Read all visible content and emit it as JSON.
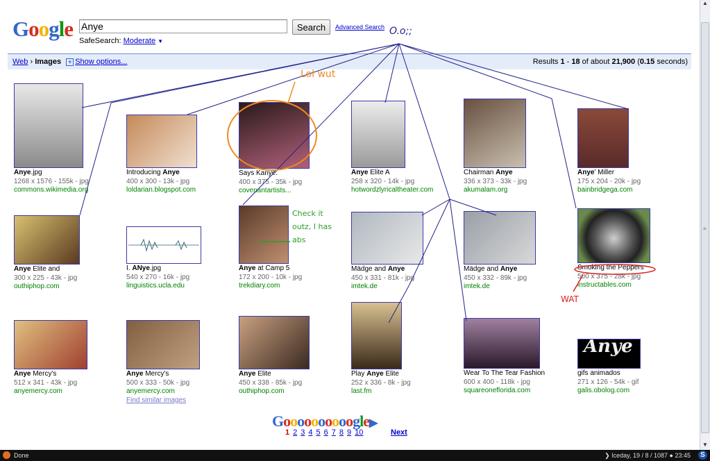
{
  "header": {
    "logo_letters": [
      {
        "ch": "G",
        "color": "#3366cc"
      },
      {
        "ch": "o",
        "color": "#d62d20"
      },
      {
        "ch": "o",
        "color": "#f4b400"
      },
      {
        "ch": "g",
        "color": "#3366cc"
      },
      {
        "ch": "l",
        "color": "#109618"
      },
      {
        "ch": "e",
        "color": "#d62d20"
      }
    ],
    "search_value": "Anye",
    "search_button": "Search",
    "advanced_link": "Advanced Search",
    "safesearch_label": "SafeSearch:",
    "safesearch_value": "Moderate",
    "safesearch_arrow": "▼"
  },
  "results_bar": {
    "web": "Web",
    "sep": "›",
    "images": "Images",
    "show_options": "Show options...",
    "results_pre": "Results ",
    "range_start": "1",
    "range_sep": " - ",
    "range_end": "18",
    "of_about": " of about ",
    "total": "21,900",
    "time_pre": " (",
    "time": "0.15",
    "time_post": " seconds)"
  },
  "results": [
    {
      "title_bold": "Anye",
      "title_rest": ".jpg",
      "meta": "1268 x 1576 - 155k - jpg",
      "site": "commons.wikimedia.org"
    },
    {
      "title_pre": "Introducing ",
      "title_bold": "Anye",
      "title_rest": "",
      "meta": "400 x 300 - 13k - jpg",
      "site": "loldarian.blogspot.com"
    },
    {
      "title_pre": "Says Kanye:",
      "title_bold": "",
      "title_rest": "",
      "meta": "400 x 375 - 35k - jpg",
      "site": "covenantartists..."
    },
    {
      "title_bold": "Anye",
      "title_rest": " Elite A",
      "meta": "258 x 320 - 14k - jpg",
      "site": "hotwordzlyricaltheater.com"
    },
    {
      "title_pre": "Chairman ",
      "title_bold": "Anye",
      "title_rest": "",
      "meta": "336 x 373 - 33k - jpg",
      "site": "akumalam.org"
    },
    {
      "title_bold": "Anye",
      "title_rest": "' Miller",
      "meta": "175 x 204 - 20k - jpg",
      "site": "bainbridgega.com"
    },
    {
      "title_bold": "Anye",
      "title_rest": " Elite and",
      "meta": "300 x 225 - 43k - jpg",
      "site": "outhiphop.com"
    },
    {
      "title_pre": "I. ",
      "title_bold": "ANye",
      "title_rest": ".jpg",
      "meta": "540 x 270 - 16k - jpg",
      "site": "linguistics.ucla.edu"
    },
    {
      "title_bold": "Anye",
      "title_rest": " at Camp 5",
      "meta": "172 x 200 - 10k - jpg",
      "site": "trekdiary.com"
    },
    {
      "title_pre": "Mädge and ",
      "title_bold": "Anye",
      "title_rest": "",
      "meta": "450 x 331 - 81k - jpg",
      "site": "imtek.de"
    },
    {
      "title_pre": "Mädge and ",
      "title_bold": "Anye",
      "title_rest": "",
      "meta": "450 x 332 - 89k - jpg",
      "site": "imtek.de"
    },
    {
      "title_pre": "Smoking the Peppers",
      "title_bold": "",
      "title_rest": "",
      "meta": "500 x 375 - 28k - jpg",
      "site": "instructables.com"
    },
    {
      "title_bold": "Anye",
      "title_rest": " Mercy's",
      "meta": "512 x 341 - 43k - jpg",
      "site": "anyemercy.com"
    },
    {
      "title_bold": "Anye",
      "title_rest": " Mercy's",
      "meta": "500 x 333 - 50k - jpg",
      "site": "anyemercy.com",
      "similar": "Find similar images"
    },
    {
      "title_bold": "Anye",
      "title_rest": " Elite",
      "meta": "450 x 338 - 85k - jpg",
      "site": "outhiphop.com"
    },
    {
      "title_pre": "Play ",
      "title_bold": "Anye",
      "title_rest": " Elite",
      "meta": "252 x 336 - 8k - jpg",
      "site": "last.fm"
    },
    {
      "title_pre": "Wear To The Tear Fashion",
      "title_bold": "",
      "title_rest": "",
      "meta": "600 x 400 - 118k - jpg",
      "site": "squareoneflorida.com"
    },
    {
      "title_pre": "gifs animados",
      "title_bold": "",
      "title_rest": "",
      "meta": "271 x 126 - 54k - gif",
      "site": "galis.obolog.com",
      "thumb_text": "Anye"
    }
  ],
  "pagination": {
    "goo_letters": [
      {
        "ch": "G",
        "color": "#3366cc"
      },
      {
        "ch": "o",
        "color": "#d62d20"
      },
      {
        "ch": "o",
        "color": "#f4b400"
      },
      {
        "ch": "o",
        "color": "#3366cc"
      },
      {
        "ch": "o",
        "color": "#d62d20"
      },
      {
        "ch": "o",
        "color": "#f4b400"
      },
      {
        "ch": "o",
        "color": "#3366cc"
      },
      {
        "ch": "o",
        "color": "#d62d20"
      },
      {
        "ch": "o",
        "color": "#f4b400"
      },
      {
        "ch": "o",
        "color": "#3366cc"
      },
      {
        "ch": "o",
        "color": "#d62d20"
      },
      {
        "ch": "g",
        "color": "#3366cc"
      },
      {
        "ch": "l",
        "color": "#109618"
      },
      {
        "ch": "e",
        "color": "#d62d20"
      }
    ],
    "arrow": "▶",
    "pages": [
      "1",
      "2",
      "3",
      "4",
      "5",
      "6",
      "7",
      "8",
      "9",
      "10"
    ],
    "current": "1",
    "next": "Next"
  },
  "status": {
    "done": "Done",
    "clock": "❯ Iceday, 19 / 8 / 1087  ● 23:45",
    "s_icon": "S"
  },
  "annotations": {
    "oo": "O.o;;",
    "lol": "Lol wut",
    "abs": "Check it\noutz, I has\nabs",
    "wat": "WAT",
    "colors": {
      "blue": "#22228a",
      "orange": "#f08a1c",
      "green": "#2aa02a",
      "red": "#d62020"
    }
  }
}
